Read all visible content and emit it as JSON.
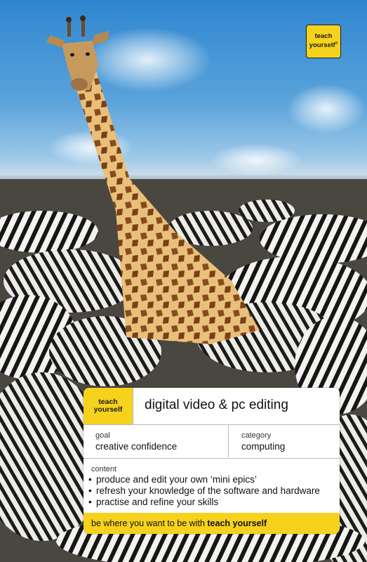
{
  "logo": {
    "line1": "teach",
    "line2": "yourself",
    "mark": "®"
  },
  "panel": {
    "mini_logo": {
      "line1": "teach",
      "line2": "yourself"
    },
    "title": "digital video & pc editing",
    "goal": {
      "label": "goal",
      "value": "creative confidence"
    },
    "category": {
      "label": "category",
      "value": "computing"
    },
    "content": {
      "label": "content",
      "bullets": [
        "produce and edit your own ‘mini epics’",
        "refresh your knowledge of the software and hardware",
        "practise and refine your skills"
      ],
      "bullet_glyph": "•"
    },
    "footer": {
      "text": "be where you want to be with ",
      "bold": "teach yourself"
    }
  },
  "colors": {
    "sky": "#2f86cf",
    "brand_yellow": "#f6d21c"
  },
  "image": {
    "subject_icon": "giraffe-among-zebras-icon"
  }
}
